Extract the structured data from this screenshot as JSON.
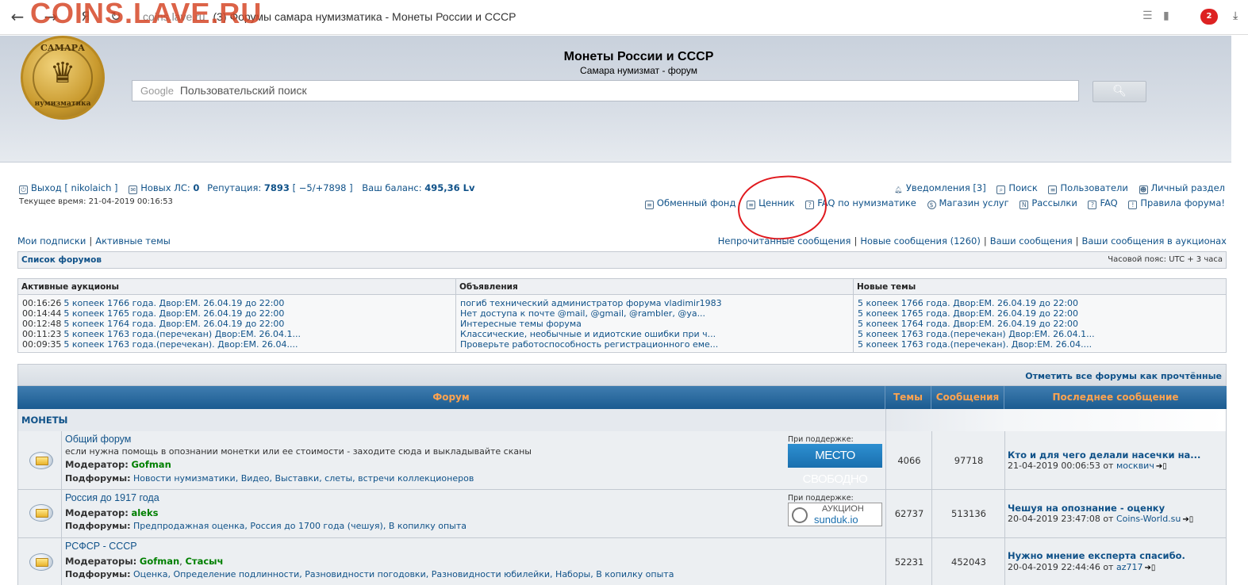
{
  "browser": {
    "tab_title": "(3) Форумы самара нумизматика - Монеты России и СССР",
    "url_domain": "coins.lave.ru",
    "watermark": "COINS.LAVE.RU",
    "ext_badge": "2"
  },
  "header": {
    "logo_top": "САМАРА",
    "logo_bottom": "нумизматика",
    "title": "Монеты России и СССР",
    "subtitle": "Самара нумизмат - форум",
    "search_google": "Google",
    "search_placeholder": "Пользовательский поиск"
  },
  "userbar": {
    "logout": "Выход [ nikolaich ]",
    "new_pm_label": "Новых ЛС:",
    "new_pm_value": "0",
    "rep_label": "Репутация:",
    "rep_value": "7893",
    "rep_detail": "[ −5/+7898 ]",
    "balance_label": "Ваш баланс:",
    "balance_value": "495,36 Lv",
    "current_time": "Текущее время: 21-04-2019 00:16:53",
    "notifications": "Уведомления [3]",
    "search": "Поиск",
    "users": "Пользователи",
    "personal": "Личный раздел",
    "exchange": "Обменный фонд",
    "pricelist": "Ценник",
    "faq_numis": "FAQ по нумизматике",
    "shop": "Магазин услуг",
    "mailings": "Рассылки",
    "faq": "FAQ",
    "rules": "Правила форума!"
  },
  "links": {
    "subscriptions": "Мои подписки",
    "active_topics": "Активные темы",
    "unread": "Непрочитанные сообщения",
    "new_posts": "Новые сообщения (1260)",
    "your_posts": "Ваши сообщения",
    "your_auction_posts": "Ваши сообщения в аукционах"
  },
  "forum_bar": {
    "left": "Список форумов",
    "right": "Часовой пояс: UTC + 3 часа"
  },
  "auctions": {
    "header": "Активные аукционы",
    "rows": [
      {
        "time": "00:16:26",
        "text": "5 копеек 1766 года. Двор:ЕМ. 26.04.19 до 22:00"
      },
      {
        "time": "00:14:44",
        "text": "5 копеек 1765 года. Двор:ЕМ. 26.04.19 до 22:00"
      },
      {
        "time": "00:12:48",
        "text": "5 копеек 1764 года. Двор:ЕМ. 26.04.19 до 22:00"
      },
      {
        "time": "00:11:23",
        "text": "5 копеек 1763 года.(перечекан) Двор:ЕМ. 26.04.1..."
      },
      {
        "time": "00:09:35",
        "text": "5 копеек 1763 года.(перечекан). Двор:ЕМ. 26.04...."
      }
    ]
  },
  "announcements": {
    "header": "Объявления",
    "rows": [
      "погиб технический администратор форума vladimir1983",
      "Нет доступа к почте @mail, @gmail, @rambler, @ya...",
      "Интересные темы форума",
      "Классические, необычные и идиотские ошибки при ч...",
      "Проверьте работоспособность регистрационного еме..."
    ]
  },
  "new_topics": {
    "header": "Новые темы",
    "rows": [
      "5 копеек 1766 года. Двор:ЕМ. 26.04.19 до 22:00",
      "5 копеек 1765 года. Двор:ЕМ. 26.04.19 до 22:00",
      "5 копеек 1764 года. Двор:ЕМ. 26.04.19 до 22:00",
      "5 копеек 1763 года.(перечекан) Двор:ЕМ. 26.04.1...",
      "5 копеек 1763 года.(перечекан). Двор:ЕМ. 26.04...."
    ]
  },
  "table": {
    "mark_read": "Отметить все форумы как прочтённые",
    "col_forum": "Форум",
    "col_topics": "Темы",
    "col_posts": "Сообщения",
    "col_last": "Последнее сообщение",
    "category": "МОНЕТЫ",
    "forums": [
      {
        "title": "Общий форум",
        "desc": "если нужна помощь в опознании монетки или ее стоимости - заходите сюда и выкладывайте сканы",
        "mod_label": "Модератор:",
        "mods": "Gofman",
        "sub_label": "Подфорумы:",
        "subs": "Новости нумизматики, Видео, Выставки, слеты, встречи коллекционеров",
        "sponsor": "При поддержке:",
        "banner": "МЕСТО СВОБОДНО",
        "topics": "4066",
        "posts": "97718",
        "last_title": "Кто и для чего делали насечки на...",
        "last_date": "21-04-2019 00:06:53",
        "last_by": "от",
        "last_user": "москвич"
      },
      {
        "title": "Россия до 1917 года",
        "desc": "",
        "mod_label": "Модератор:",
        "mods": "aleks",
        "sub_label": "Подфорумы:",
        "subs": "Предпродажная оценка, Россия до 1700 года (чешуя), В копилку опыта",
        "sponsor": "При поддержке:",
        "banner_t1": "АУКЦИОН",
        "banner_t2": "sunduk.io",
        "topics": "62737",
        "posts": "513136",
        "last_title": "Чешуя на опознание - оценку",
        "last_date": "20-04-2019 23:47:08",
        "last_by": "от",
        "last_user": "Coins-World.su"
      },
      {
        "title": "РСФСР - СССР",
        "desc": "",
        "mod_label": "Модераторы:",
        "mods1": "Gofman",
        "mods2": "Стасыч",
        "sub_label": "Подфорумы:",
        "subs": "Оценка, Определение подлинности, Разновидности погодовки, Разновидности юбилейки, Наборы, В копилку опыта",
        "topics": "52231",
        "posts": "452043",
        "last_title": "Нужно мнение експерта спасибо.",
        "last_date": "20-04-2019 22:44:46",
        "last_by": "от",
        "last_user": "az717"
      }
    ]
  }
}
